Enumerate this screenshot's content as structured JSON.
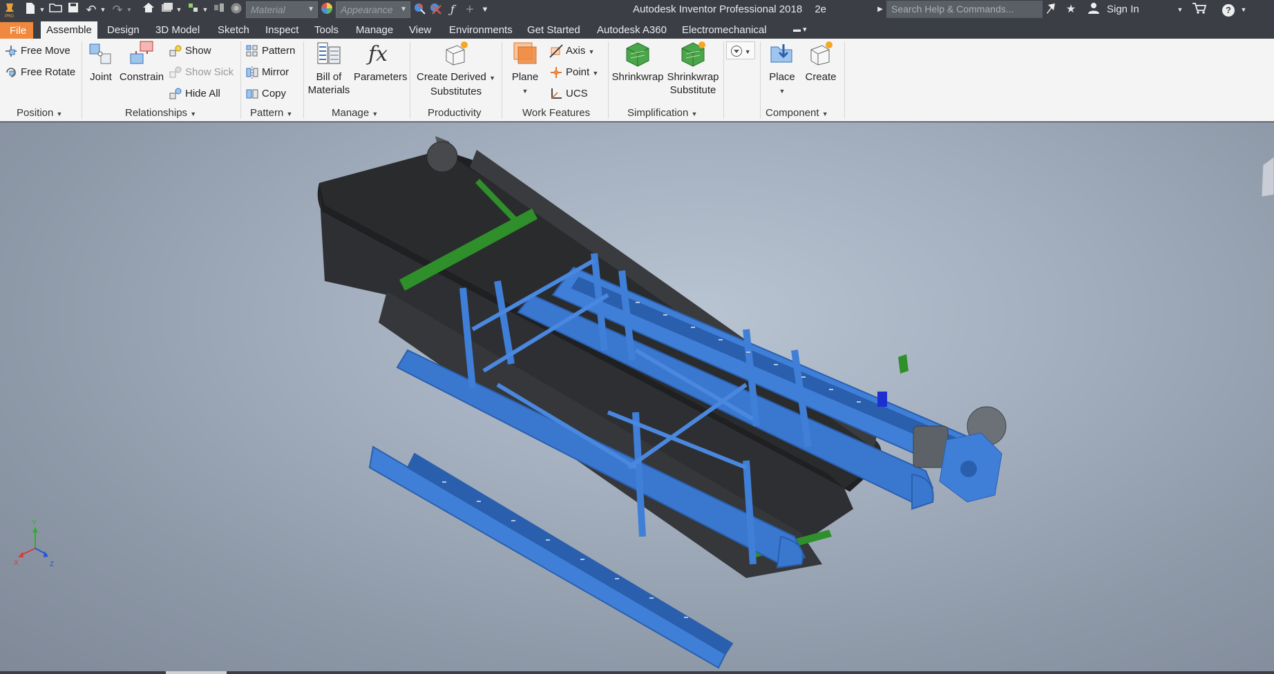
{
  "app": {
    "title": "Autodesk Inventor Professional 2018",
    "doc_title": "2e",
    "logo_text": "PRO"
  },
  "quick_access": {
    "material_placeholder": "Material",
    "appearance_placeholder": "Appearance"
  },
  "help": {
    "search_placeholder": "Search Help & Commands...",
    "sign_in_label": "Sign In",
    "help_label": "?"
  },
  "tabs": [
    {
      "label": "File"
    },
    {
      "label": "Assemble"
    },
    {
      "label": "Design"
    },
    {
      "label": "3D Model"
    },
    {
      "label": "Sketch"
    },
    {
      "label": "Inspect"
    },
    {
      "label": "Tools"
    },
    {
      "label": "Manage"
    },
    {
      "label": "View"
    },
    {
      "label": "Environments"
    },
    {
      "label": "Get Started"
    },
    {
      "label": "Autodesk A360"
    },
    {
      "label": "Electromechanical"
    }
  ],
  "ribbon": {
    "position": {
      "title": "Position",
      "free_move": "Free Move",
      "free_rotate": "Free Rotate"
    },
    "relationships": {
      "title": "Relationships",
      "joint": "Joint",
      "constrain": "Constrain",
      "show": "Show",
      "show_sick": "Show Sick",
      "hide_all": "Hide All"
    },
    "pattern": {
      "title": "Pattern",
      "pattern": "Pattern",
      "mirror": "Mirror",
      "copy": "Copy"
    },
    "manage": {
      "title": "Manage",
      "bom_line1": "Bill of",
      "bom_line2": "Materials",
      "parameters": "Parameters"
    },
    "productivity": {
      "title": "Productivity",
      "cds_line1": "Create Derived",
      "cds_line2": "Substitutes"
    },
    "work_features": {
      "title": "Work Features",
      "plane": "Plane",
      "axis": "Axis",
      "point": "Point",
      "ucs": "UCS"
    },
    "simplification": {
      "title": "Simplification",
      "shrinkwrap": "Shrinkwrap",
      "sws_line1": "Shrinkwrap",
      "sws_line2": "Substitute"
    },
    "component": {
      "title": "Component",
      "place": "Place",
      "create": "Create"
    }
  },
  "triad": {
    "x": "X",
    "y": "Y",
    "z": "Z"
  },
  "colors": {
    "frame_blue": "#3f7fd8",
    "frame_blue_dark": "#2a5fae",
    "belt": "#262729",
    "roller_green": "#2f8f2a",
    "file_tab": "#f0883e"
  }
}
